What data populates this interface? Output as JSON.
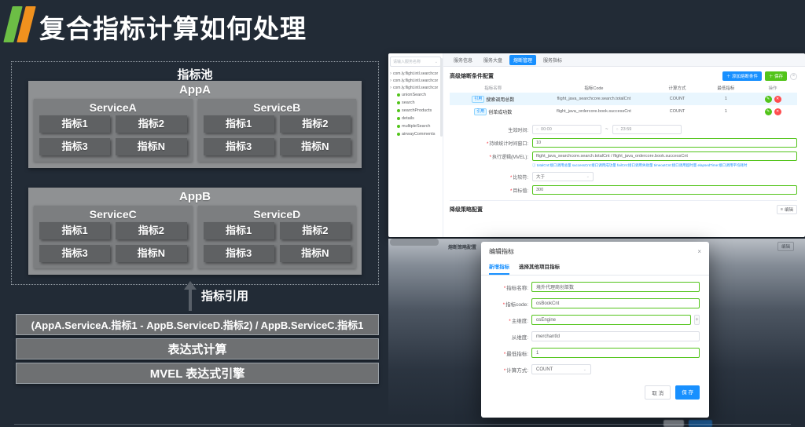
{
  "slide": {
    "title": "复合指标计算如何处理",
    "colors": {
      "accent_green": "#6cbe45",
      "accent_orange": "#f0911e",
      "background": "#222b36",
      "primary_blue": "#1890ff",
      "success_green": "#52c41a",
      "danger_red": "#ff4d4f"
    }
  },
  "icons": {
    "chevron_down": "⌄",
    "caret_right": "›",
    "close": "×",
    "collapse_circle": "×",
    "clock": "○",
    "info": "ⓘ",
    "edit_pencil": "✎",
    "delete_cross": "✕",
    "plus": "+",
    "menu": "≡",
    "tilde": "~"
  },
  "diagram": {
    "pool_title": "指标池",
    "arrow_label": "指标引用",
    "apps": [
      {
        "name": "AppA",
        "services": [
          {
            "name": "ServiceA",
            "metrics": [
              "指标1",
              "指标2",
              "指标3",
              "指标N"
            ]
          },
          {
            "name": "ServiceB",
            "metrics": [
              "指标1",
              "指标2",
              "指标3",
              "指标N"
            ]
          }
        ]
      },
      {
        "name": "AppB",
        "services": [
          {
            "name": "ServiceC",
            "metrics": [
              "指标1",
              "指标2",
              "指标3",
              "指标N"
            ]
          },
          {
            "name": "ServiceD",
            "metrics": [
              "指标1",
              "指标2",
              "指标3",
              "指标N"
            ]
          }
        ]
      }
    ],
    "bars": [
      "(AppA.ServiceA.指标1 - AppB.ServiceD.指标2) / AppB.ServiceC.指标1",
      "表达式计算",
      "MVEL 表达式引擎"
    ]
  },
  "screenshot1": {
    "sidebar": {
      "select_placeholder": "请输入服务名称",
      "roots": [
        "com.ly.flight.intl.searchcor",
        "com.ly.flight.intl.searchcor",
        "com.ly.flight.intl.searchcor"
      ],
      "children": [
        "unionSearch",
        "search",
        "searchProducts",
        "details",
        "multipleSearch",
        "airwayComments"
      ]
    },
    "tabs": [
      {
        "label": "服务信息"
      },
      {
        "label": "服务大盘"
      },
      {
        "label": "熔断管理"
      },
      {
        "label": "服务指标"
      }
    ],
    "section_title": "高级熔断条件配置",
    "buttons": {
      "add": "＋ 添加熔断条件",
      "save": "＋ 保存"
    },
    "table": {
      "headers": [
        "指标名称",
        "指标Code",
        "计算方式",
        "最低指标",
        "操作"
      ],
      "rows": [
        {
          "tag": "引用",
          "name": "搜索调用总数",
          "code": "flight_java_searchcore.search.totalCnt",
          "calc": "COUNT",
          "min": "1"
        },
        {
          "tag": "引用",
          "name": "创单成功数",
          "code": "flight_java_ordercore.book.successCnt",
          "calc": "COUNT",
          "min": "1"
        }
      ]
    },
    "form": {
      "required_mark": "*",
      "time_label": "生效时间:",
      "time_from": "00:00",
      "time_sep": "~",
      "time_to": "23:59",
      "window_label": "持续统计时间窗口:",
      "window_value": "10",
      "mvel_label": "执行逻辑(MVEL):",
      "mvel_value": "flight_java_searchcore.search.totalCnt / flight_java_ordercore.book.successCnt",
      "hint": "totalCnt:接口调用总量 successCnt:接口调用成功量 failCnt:接口调用失败量 timeoutCnt:接口调用超时量 elapsedTime:接口调用平均耗时",
      "compare_label": "比较符:",
      "compare_value": "大于",
      "target_label": "目标值:",
      "target_value": "300"
    },
    "footer": {
      "title": "降级策略配置",
      "edit": "编辑"
    }
  },
  "screenshot2": {
    "section_title": "熔断策略配置",
    "edit": "编辑"
  },
  "dialog": {
    "title": "编辑指标",
    "required_mark": "*",
    "tabs": [
      {
        "label": "新增指标"
      },
      {
        "label": "选择其他项目指标"
      }
    ],
    "fields": [
      {
        "label": "指标名称:",
        "value": "境外代理商创单数"
      },
      {
        "label": "指标code:",
        "value": "osBookCnt"
      },
      {
        "label": "主维度:",
        "value": "osEngine"
      },
      {
        "label": "从维度:",
        "value": "merchantId"
      },
      {
        "label": "最低指标:",
        "value": "1"
      },
      {
        "label": "计算方式:",
        "value": "COUNT"
      }
    ],
    "cancel": "取 消",
    "save": "保 存"
  }
}
